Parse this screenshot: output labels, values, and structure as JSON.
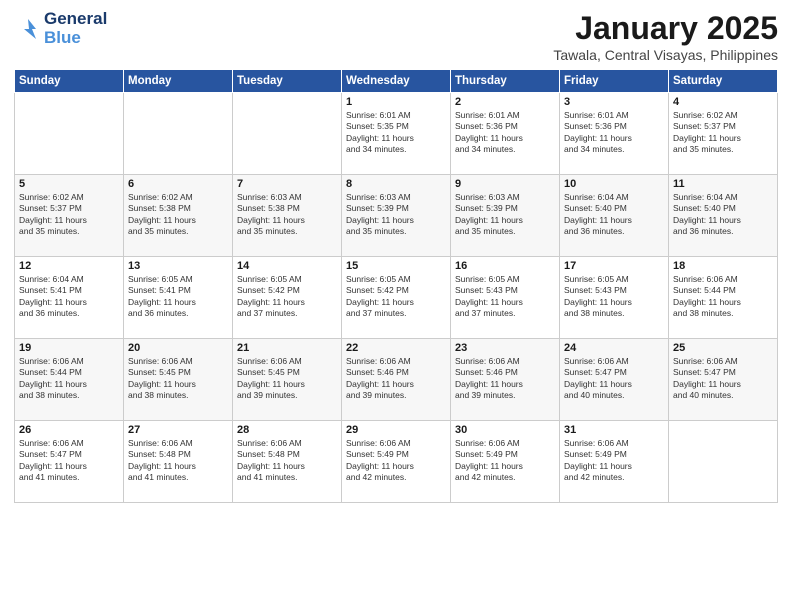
{
  "header": {
    "logo_general": "General",
    "logo_blue": "Blue",
    "title": "January 2025",
    "subtitle": "Tawala, Central Visayas, Philippines"
  },
  "weekdays": [
    "Sunday",
    "Monday",
    "Tuesday",
    "Wednesday",
    "Thursday",
    "Friday",
    "Saturday"
  ],
  "weeks": [
    [
      {
        "day": "",
        "info": ""
      },
      {
        "day": "",
        "info": ""
      },
      {
        "day": "",
        "info": ""
      },
      {
        "day": "1",
        "info": "Sunrise: 6:01 AM\nSunset: 5:35 PM\nDaylight: 11 hours\nand 34 minutes."
      },
      {
        "day": "2",
        "info": "Sunrise: 6:01 AM\nSunset: 5:36 PM\nDaylight: 11 hours\nand 34 minutes."
      },
      {
        "day": "3",
        "info": "Sunrise: 6:01 AM\nSunset: 5:36 PM\nDaylight: 11 hours\nand 34 minutes."
      },
      {
        "day": "4",
        "info": "Sunrise: 6:02 AM\nSunset: 5:37 PM\nDaylight: 11 hours\nand 35 minutes."
      }
    ],
    [
      {
        "day": "5",
        "info": "Sunrise: 6:02 AM\nSunset: 5:37 PM\nDaylight: 11 hours\nand 35 minutes."
      },
      {
        "day": "6",
        "info": "Sunrise: 6:02 AM\nSunset: 5:38 PM\nDaylight: 11 hours\nand 35 minutes."
      },
      {
        "day": "7",
        "info": "Sunrise: 6:03 AM\nSunset: 5:38 PM\nDaylight: 11 hours\nand 35 minutes."
      },
      {
        "day": "8",
        "info": "Sunrise: 6:03 AM\nSunset: 5:39 PM\nDaylight: 11 hours\nand 35 minutes."
      },
      {
        "day": "9",
        "info": "Sunrise: 6:03 AM\nSunset: 5:39 PM\nDaylight: 11 hours\nand 35 minutes."
      },
      {
        "day": "10",
        "info": "Sunrise: 6:04 AM\nSunset: 5:40 PM\nDaylight: 11 hours\nand 36 minutes."
      },
      {
        "day": "11",
        "info": "Sunrise: 6:04 AM\nSunset: 5:40 PM\nDaylight: 11 hours\nand 36 minutes."
      }
    ],
    [
      {
        "day": "12",
        "info": "Sunrise: 6:04 AM\nSunset: 5:41 PM\nDaylight: 11 hours\nand 36 minutes."
      },
      {
        "day": "13",
        "info": "Sunrise: 6:05 AM\nSunset: 5:41 PM\nDaylight: 11 hours\nand 36 minutes."
      },
      {
        "day": "14",
        "info": "Sunrise: 6:05 AM\nSunset: 5:42 PM\nDaylight: 11 hours\nand 37 minutes."
      },
      {
        "day": "15",
        "info": "Sunrise: 6:05 AM\nSunset: 5:42 PM\nDaylight: 11 hours\nand 37 minutes."
      },
      {
        "day": "16",
        "info": "Sunrise: 6:05 AM\nSunset: 5:43 PM\nDaylight: 11 hours\nand 37 minutes."
      },
      {
        "day": "17",
        "info": "Sunrise: 6:05 AM\nSunset: 5:43 PM\nDaylight: 11 hours\nand 38 minutes."
      },
      {
        "day": "18",
        "info": "Sunrise: 6:06 AM\nSunset: 5:44 PM\nDaylight: 11 hours\nand 38 minutes."
      }
    ],
    [
      {
        "day": "19",
        "info": "Sunrise: 6:06 AM\nSunset: 5:44 PM\nDaylight: 11 hours\nand 38 minutes."
      },
      {
        "day": "20",
        "info": "Sunrise: 6:06 AM\nSunset: 5:45 PM\nDaylight: 11 hours\nand 38 minutes."
      },
      {
        "day": "21",
        "info": "Sunrise: 6:06 AM\nSunset: 5:45 PM\nDaylight: 11 hours\nand 39 minutes."
      },
      {
        "day": "22",
        "info": "Sunrise: 6:06 AM\nSunset: 5:46 PM\nDaylight: 11 hours\nand 39 minutes."
      },
      {
        "day": "23",
        "info": "Sunrise: 6:06 AM\nSunset: 5:46 PM\nDaylight: 11 hours\nand 39 minutes."
      },
      {
        "day": "24",
        "info": "Sunrise: 6:06 AM\nSunset: 5:47 PM\nDaylight: 11 hours\nand 40 minutes."
      },
      {
        "day": "25",
        "info": "Sunrise: 6:06 AM\nSunset: 5:47 PM\nDaylight: 11 hours\nand 40 minutes."
      }
    ],
    [
      {
        "day": "26",
        "info": "Sunrise: 6:06 AM\nSunset: 5:47 PM\nDaylight: 11 hours\nand 41 minutes."
      },
      {
        "day": "27",
        "info": "Sunrise: 6:06 AM\nSunset: 5:48 PM\nDaylight: 11 hours\nand 41 minutes."
      },
      {
        "day": "28",
        "info": "Sunrise: 6:06 AM\nSunset: 5:48 PM\nDaylight: 11 hours\nand 41 minutes."
      },
      {
        "day": "29",
        "info": "Sunrise: 6:06 AM\nSunset: 5:49 PM\nDaylight: 11 hours\nand 42 minutes."
      },
      {
        "day": "30",
        "info": "Sunrise: 6:06 AM\nSunset: 5:49 PM\nDaylight: 11 hours\nand 42 minutes."
      },
      {
        "day": "31",
        "info": "Sunrise: 6:06 AM\nSunset: 5:49 PM\nDaylight: 11 hours\nand 42 minutes."
      },
      {
        "day": "",
        "info": ""
      }
    ]
  ]
}
